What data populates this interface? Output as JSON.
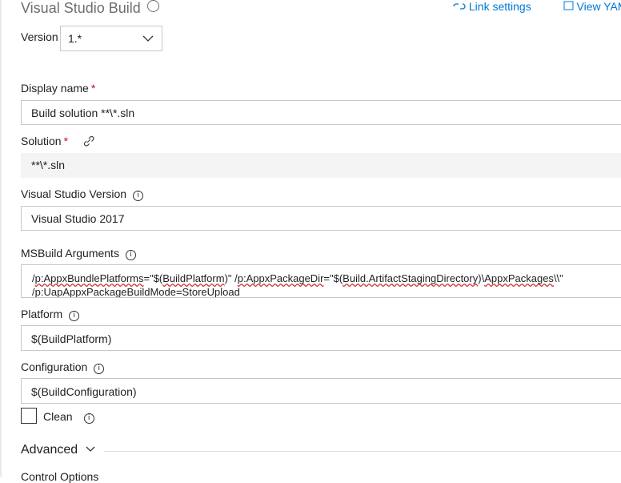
{
  "task": {
    "title": "Visual Studio Build",
    "link_settings": "Link settings",
    "view_yaml": "View YAML"
  },
  "version": {
    "label": "Version",
    "value": "1.*"
  },
  "display_name": {
    "label": "Display name",
    "required_marker": "*",
    "value": "Build solution **\\*.sln"
  },
  "solution": {
    "label": "Solution",
    "required_marker": "*",
    "value": "**\\*.sln"
  },
  "vs_version": {
    "label": "Visual Studio Version",
    "value": "Visual Studio 2017"
  },
  "msbuild": {
    "label": "MSBuild Arguments",
    "line1_parts": [
      "/",
      "p:AppxBundlePlatforms",
      "=\"$(",
      "BuildPlatform",
      ")\" /",
      "p:AppxPackageDir",
      "=\"$(",
      "Build.ArtifactStagingDirectory",
      ")\\",
      "AppxPackages",
      "\\\\\""
    ],
    "line2_parts": [
      "/",
      "p:UapAppxPackageBuildMode",
      "=StoreUpload"
    ]
  },
  "platform": {
    "label": "Platform",
    "value": "$(BuildPlatform)"
  },
  "configuration": {
    "label": "Configuration",
    "value": "$(BuildConfiguration)"
  },
  "clean": {
    "label": "Clean",
    "checked": false
  },
  "advanced": {
    "label": "Advanced"
  },
  "next_section": {
    "label": "Control Options"
  },
  "icons": {
    "info": "info-icon",
    "link": "link-icon",
    "chevron": "chevron-down-icon"
  }
}
